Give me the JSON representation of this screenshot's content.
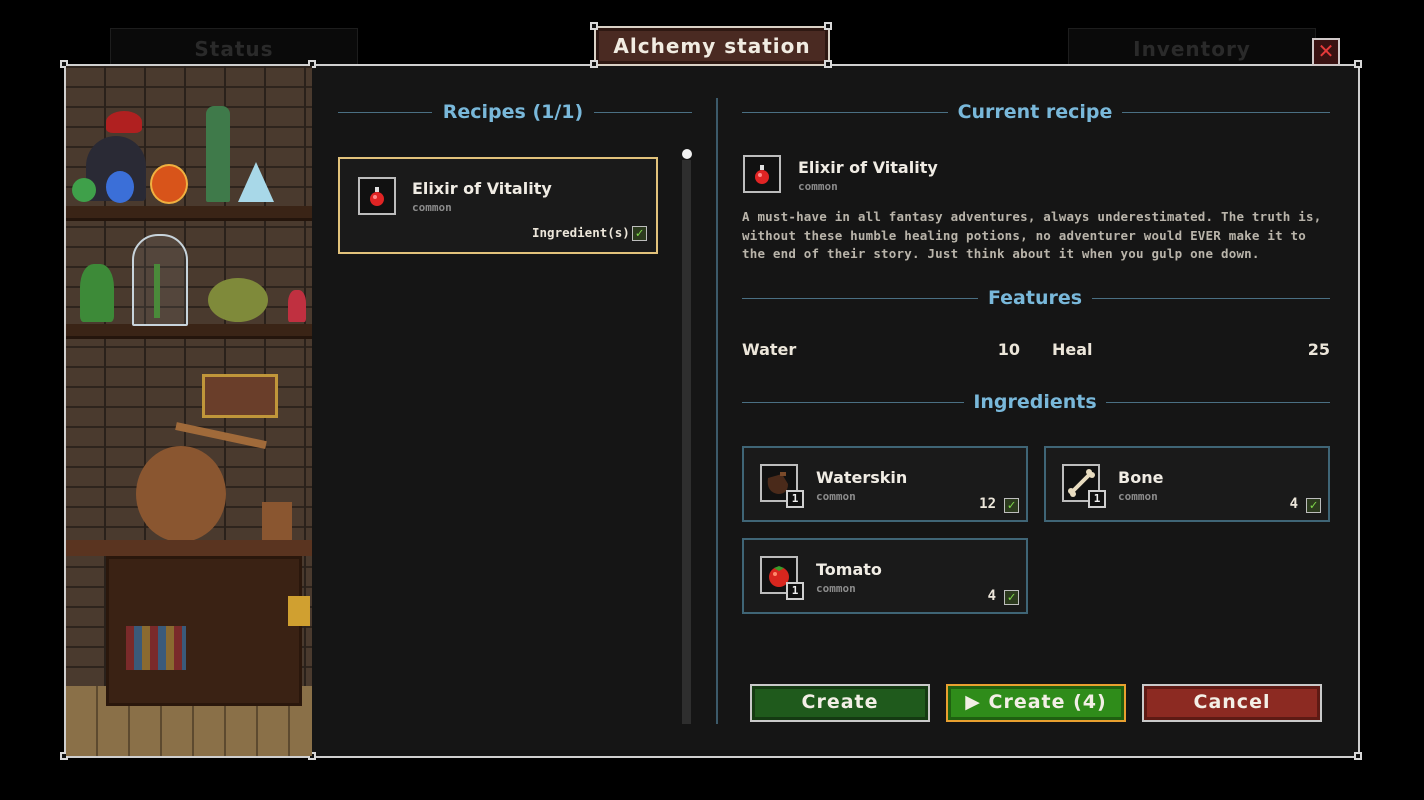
{
  "window": {
    "title": "Alchemy station",
    "close_glyph": "✕",
    "bg_tabs": [
      "Status",
      "Inventory"
    ]
  },
  "colors": {
    "frame_bg": "#151515",
    "accent_blue": "#79b8da",
    "selected_border": "#e2c27b",
    "create_green": "#1f5a1c",
    "create_all_green": "#2f8c1a",
    "cancel_red": "#8c2a22"
  },
  "recipes": {
    "title": "Recipes (1/1)",
    "items": [
      {
        "name": "Elixir of Vitality",
        "rarity": "common",
        "status_label": "Ingredient(s)",
        "status_check": "✓",
        "icon": "red-potion-icon"
      }
    ]
  },
  "current": {
    "title": "Current recipe",
    "name": "Elixir of Vitality",
    "rarity": "common",
    "icon": "red-potion-icon",
    "description": "A must-have in all fantasy adventures, always underestimated. The truth is, without these humble healing potions, no adventurer would EVER make it to the end of their story. Just think about it when you gulp one down.",
    "features_title": "Features",
    "features": [
      {
        "label": "Water",
        "value": "10"
      },
      {
        "label": "Heal",
        "value": "25"
      }
    ],
    "ingredients_title": "Ingredients",
    "ingredients": [
      {
        "name": "Waterskin",
        "rarity": "common",
        "required": "1",
        "owned": "12",
        "check": "✓",
        "icon": "waterskin-icon"
      },
      {
        "name": "Bone",
        "rarity": "common",
        "required": "1",
        "owned": "4",
        "check": "✓",
        "icon": "bone-icon"
      },
      {
        "name": "Tomato",
        "rarity": "common",
        "required": "1",
        "owned": "4",
        "check": "✓",
        "icon": "tomato-icon"
      }
    ]
  },
  "buttons": {
    "create": "Create",
    "create_all": "▶ Create (4)",
    "cancel": "Cancel"
  }
}
